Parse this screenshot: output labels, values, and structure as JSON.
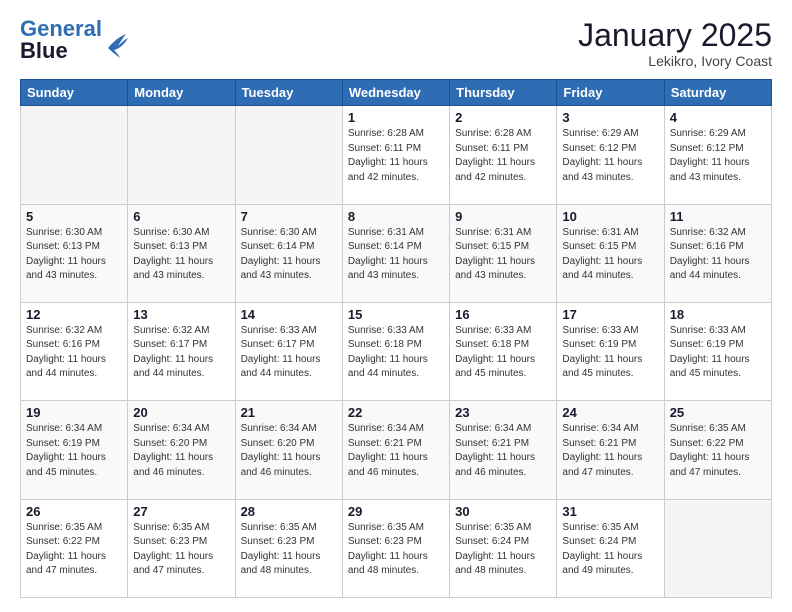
{
  "header": {
    "logo_line1": "General",
    "logo_line2": "Blue",
    "month": "January 2025",
    "location": "Lekikro, Ivory Coast"
  },
  "weekdays": [
    "Sunday",
    "Monday",
    "Tuesday",
    "Wednesday",
    "Thursday",
    "Friday",
    "Saturday"
  ],
  "rows": [
    [
      {
        "day": "",
        "info": ""
      },
      {
        "day": "",
        "info": ""
      },
      {
        "day": "",
        "info": ""
      },
      {
        "day": "1",
        "info": "Sunrise: 6:28 AM\nSunset: 6:11 PM\nDaylight: 11 hours\nand 42 minutes."
      },
      {
        "day": "2",
        "info": "Sunrise: 6:28 AM\nSunset: 6:11 PM\nDaylight: 11 hours\nand 42 minutes."
      },
      {
        "day": "3",
        "info": "Sunrise: 6:29 AM\nSunset: 6:12 PM\nDaylight: 11 hours\nand 43 minutes."
      },
      {
        "day": "4",
        "info": "Sunrise: 6:29 AM\nSunset: 6:12 PM\nDaylight: 11 hours\nand 43 minutes."
      }
    ],
    [
      {
        "day": "5",
        "info": "Sunrise: 6:30 AM\nSunset: 6:13 PM\nDaylight: 11 hours\nand 43 minutes."
      },
      {
        "day": "6",
        "info": "Sunrise: 6:30 AM\nSunset: 6:13 PM\nDaylight: 11 hours\nand 43 minutes."
      },
      {
        "day": "7",
        "info": "Sunrise: 6:30 AM\nSunset: 6:14 PM\nDaylight: 11 hours\nand 43 minutes."
      },
      {
        "day": "8",
        "info": "Sunrise: 6:31 AM\nSunset: 6:14 PM\nDaylight: 11 hours\nand 43 minutes."
      },
      {
        "day": "9",
        "info": "Sunrise: 6:31 AM\nSunset: 6:15 PM\nDaylight: 11 hours\nand 43 minutes."
      },
      {
        "day": "10",
        "info": "Sunrise: 6:31 AM\nSunset: 6:15 PM\nDaylight: 11 hours\nand 44 minutes."
      },
      {
        "day": "11",
        "info": "Sunrise: 6:32 AM\nSunset: 6:16 PM\nDaylight: 11 hours\nand 44 minutes."
      }
    ],
    [
      {
        "day": "12",
        "info": "Sunrise: 6:32 AM\nSunset: 6:16 PM\nDaylight: 11 hours\nand 44 minutes."
      },
      {
        "day": "13",
        "info": "Sunrise: 6:32 AM\nSunset: 6:17 PM\nDaylight: 11 hours\nand 44 minutes."
      },
      {
        "day": "14",
        "info": "Sunrise: 6:33 AM\nSunset: 6:17 PM\nDaylight: 11 hours\nand 44 minutes."
      },
      {
        "day": "15",
        "info": "Sunrise: 6:33 AM\nSunset: 6:18 PM\nDaylight: 11 hours\nand 44 minutes."
      },
      {
        "day": "16",
        "info": "Sunrise: 6:33 AM\nSunset: 6:18 PM\nDaylight: 11 hours\nand 45 minutes."
      },
      {
        "day": "17",
        "info": "Sunrise: 6:33 AM\nSunset: 6:19 PM\nDaylight: 11 hours\nand 45 minutes."
      },
      {
        "day": "18",
        "info": "Sunrise: 6:33 AM\nSunset: 6:19 PM\nDaylight: 11 hours\nand 45 minutes."
      }
    ],
    [
      {
        "day": "19",
        "info": "Sunrise: 6:34 AM\nSunset: 6:19 PM\nDaylight: 11 hours\nand 45 minutes."
      },
      {
        "day": "20",
        "info": "Sunrise: 6:34 AM\nSunset: 6:20 PM\nDaylight: 11 hours\nand 46 minutes."
      },
      {
        "day": "21",
        "info": "Sunrise: 6:34 AM\nSunset: 6:20 PM\nDaylight: 11 hours\nand 46 minutes."
      },
      {
        "day": "22",
        "info": "Sunrise: 6:34 AM\nSunset: 6:21 PM\nDaylight: 11 hours\nand 46 minutes."
      },
      {
        "day": "23",
        "info": "Sunrise: 6:34 AM\nSunset: 6:21 PM\nDaylight: 11 hours\nand 46 minutes."
      },
      {
        "day": "24",
        "info": "Sunrise: 6:34 AM\nSunset: 6:21 PM\nDaylight: 11 hours\nand 47 minutes."
      },
      {
        "day": "25",
        "info": "Sunrise: 6:35 AM\nSunset: 6:22 PM\nDaylight: 11 hours\nand 47 minutes."
      }
    ],
    [
      {
        "day": "26",
        "info": "Sunrise: 6:35 AM\nSunset: 6:22 PM\nDaylight: 11 hours\nand 47 minutes."
      },
      {
        "day": "27",
        "info": "Sunrise: 6:35 AM\nSunset: 6:23 PM\nDaylight: 11 hours\nand 47 minutes."
      },
      {
        "day": "28",
        "info": "Sunrise: 6:35 AM\nSunset: 6:23 PM\nDaylight: 11 hours\nand 48 minutes."
      },
      {
        "day": "29",
        "info": "Sunrise: 6:35 AM\nSunset: 6:23 PM\nDaylight: 11 hours\nand 48 minutes."
      },
      {
        "day": "30",
        "info": "Sunrise: 6:35 AM\nSunset: 6:24 PM\nDaylight: 11 hours\nand 48 minutes."
      },
      {
        "day": "31",
        "info": "Sunrise: 6:35 AM\nSunset: 6:24 PM\nDaylight: 11 hours\nand 49 minutes."
      },
      {
        "day": "",
        "info": ""
      }
    ]
  ],
  "colors": {
    "header_bg": "#2e6db4",
    "logo_blue": "#2e6db4"
  }
}
